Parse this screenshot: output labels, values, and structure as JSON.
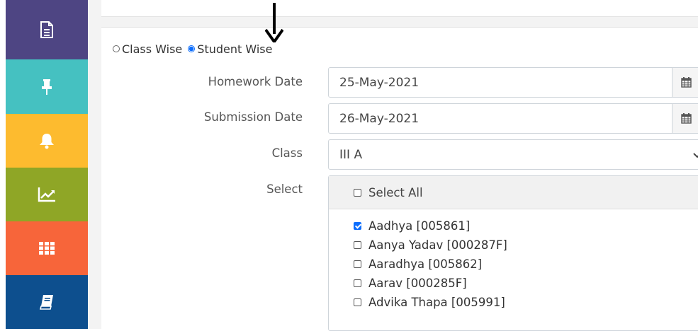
{
  "sidebar": {
    "items": [
      {
        "icon": "document-icon",
        "color": "#4e4583"
      },
      {
        "icon": "pin-icon",
        "color": "#45c1c1"
      },
      {
        "icon": "bell-icon",
        "color": "#fdbb2f"
      },
      {
        "icon": "line-chart-icon",
        "color": "#8fa626"
      },
      {
        "icon": "grid-icon",
        "color": "#f7653a"
      },
      {
        "icon": "book-icon",
        "color": "#0d4f8e"
      }
    ]
  },
  "mode": {
    "options": [
      {
        "label": "Class Wise",
        "selected": false
      },
      {
        "label": "Student Wise",
        "selected": true
      }
    ]
  },
  "form": {
    "homework_date_label": "Homework Date",
    "homework_date_value": "25-May-2021",
    "submission_date_label": "Submission Date",
    "submission_date_value": "26-May-2021",
    "class_label": "Class",
    "class_value": "III A",
    "select_label": "Select"
  },
  "students": {
    "select_all_label": "Select All",
    "select_all_checked": false,
    "items": [
      {
        "label": "Aadhya [005861]",
        "checked": true
      },
      {
        "label": "Aanya Yadav [000287F]",
        "checked": false
      },
      {
        "label": "Aaradhya [005862]",
        "checked": false
      },
      {
        "label": "Aarav [000285F]",
        "checked": false
      },
      {
        "label": "Advika Thapa [005991]",
        "checked": false
      }
    ]
  },
  "colors": {
    "accent": "#0d6efd"
  }
}
